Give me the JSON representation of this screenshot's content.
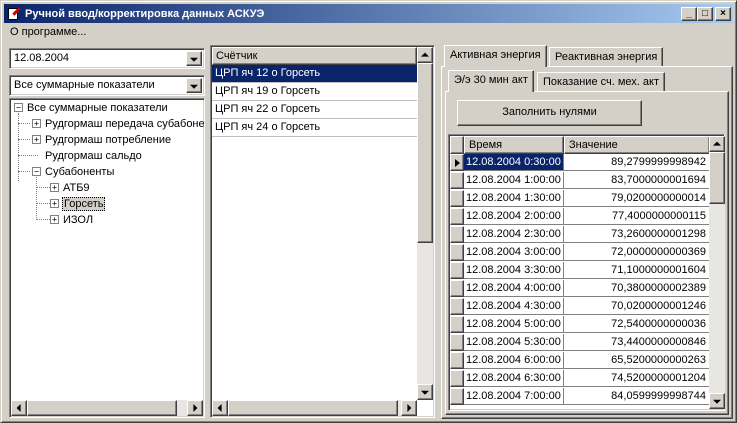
{
  "window": {
    "title": "Ручной ввод/корректировка данных АСКУЭ",
    "min_btn": "_",
    "max_btn": "□",
    "close_btn": "×"
  },
  "menu": {
    "items": [
      "О программе..."
    ]
  },
  "left": {
    "date_combo": {
      "value": "12.08.2004"
    },
    "filter_combo": {
      "value": "Все суммарные показатели"
    },
    "tree": {
      "root": "Все суммарные показатели",
      "items": [
        "Рудгормаш передача субабонентам",
        "Рудгормаш потребление",
        "Рудгормаш сальдо",
        "Субабоненты"
      ],
      "sub_items": [
        "АТБ9",
        "Горсеть",
        "ИЗОЛ"
      ],
      "expanded_sign": "−",
      "collapsed_sign": "+"
    }
  },
  "meter_list": {
    "header": "Счётчик",
    "rows": [
      "ЦРП яч 12 о Горсеть",
      "ЦРП яч 19 о Горсеть",
      "ЦРП яч 22 о Горсеть",
      "ЦРП яч 24 о Горсеть"
    ],
    "selected_index": 0
  },
  "right": {
    "top_tabs": [
      "Активная энергия",
      "Реактивная энергия"
    ],
    "sub_tabs": [
      "Э/э 30 мин акт",
      "Показание сч. мех. акт"
    ],
    "fill_button": "Заполнить нулями",
    "grid": {
      "columns": [
        "Время",
        "Значение"
      ],
      "rows": [
        [
          "12.08.2004 0:30:00",
          "89,2799999998942"
        ],
        [
          "12.08.2004 1:00:00",
          "83,7000000001694"
        ],
        [
          "12.08.2004 1:30:00",
          "79,0200000000014"
        ],
        [
          "12.08.2004 2:00:00",
          "77,4000000000115"
        ],
        [
          "12.08.2004 2:30:00",
          "73,2600000001298"
        ],
        [
          "12.08.2004 3:00:00",
          "72,0000000000369"
        ],
        [
          "12.08.2004 3:30:00",
          "71,1000000001604"
        ],
        [
          "12.08.2004 4:00:00",
          "70,3800000002389"
        ],
        [
          "12.08.2004 4:30:00",
          "70,0200000001246"
        ],
        [
          "12.08.2004 5:00:00",
          "72,5400000000036"
        ],
        [
          "12.08.2004 5:30:00",
          "73,4400000000846"
        ],
        [
          "12.08.2004 6:00:00",
          "65,5200000000263"
        ],
        [
          "12.08.2004 6:30:00",
          "74,5200000001204"
        ],
        [
          "12.08.2004 7:00:00",
          "84,0599999998744"
        ]
      ],
      "current_row": 0
    }
  },
  "colors": {
    "selection": "#0a246a",
    "face": "#d4d0c8",
    "title_start": "#0a246a",
    "title_end": "#a6caf0"
  }
}
